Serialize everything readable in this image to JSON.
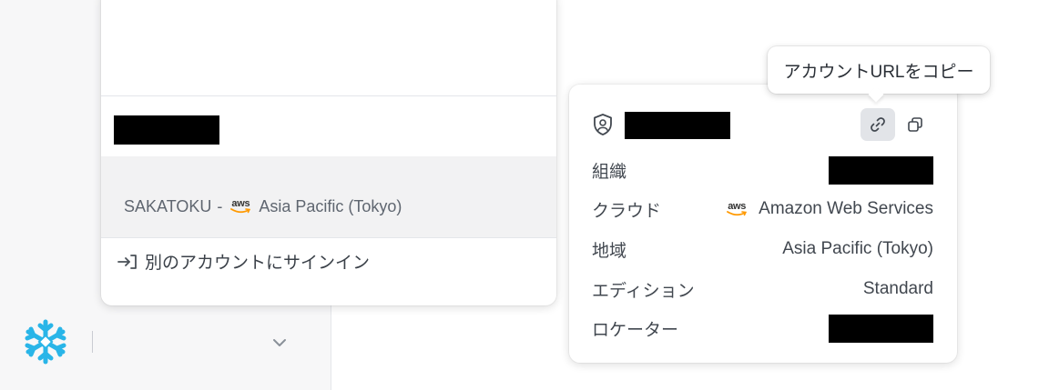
{
  "switcher": {
    "current_account_line": {
      "account": "SAKATOKU",
      "separator": "-",
      "provider_logo": "aws",
      "region": "Asia Pacific (Tokyo)"
    },
    "signin_other_label": "別のアカウントにサインイン",
    "signin_icon": "sign-in-arrow-icon"
  },
  "details": {
    "header_icon": "shield-user-icon",
    "rows": {
      "org_label": "組織",
      "cloud_label": "クラウド",
      "cloud_value": "Amazon Web Services",
      "region_label": "地域",
      "region_value": "Asia Pacific (Tokyo)",
      "edition_label": "エディション",
      "edition_value": "Standard",
      "locator_label": "ロケーター"
    }
  },
  "tooltip": {
    "text": "アカウントURLをコピー"
  },
  "icons": {
    "logo": "snowflake-logo-icon",
    "chevron": "chevron-down-icon",
    "link": "link-icon",
    "copy": "copy-icon"
  },
  "colors": {
    "brand": "#29b5e8",
    "aws_orange": "#ff9900",
    "selected_row_bg": "#f2f2f3",
    "redaction": "#000000"
  }
}
